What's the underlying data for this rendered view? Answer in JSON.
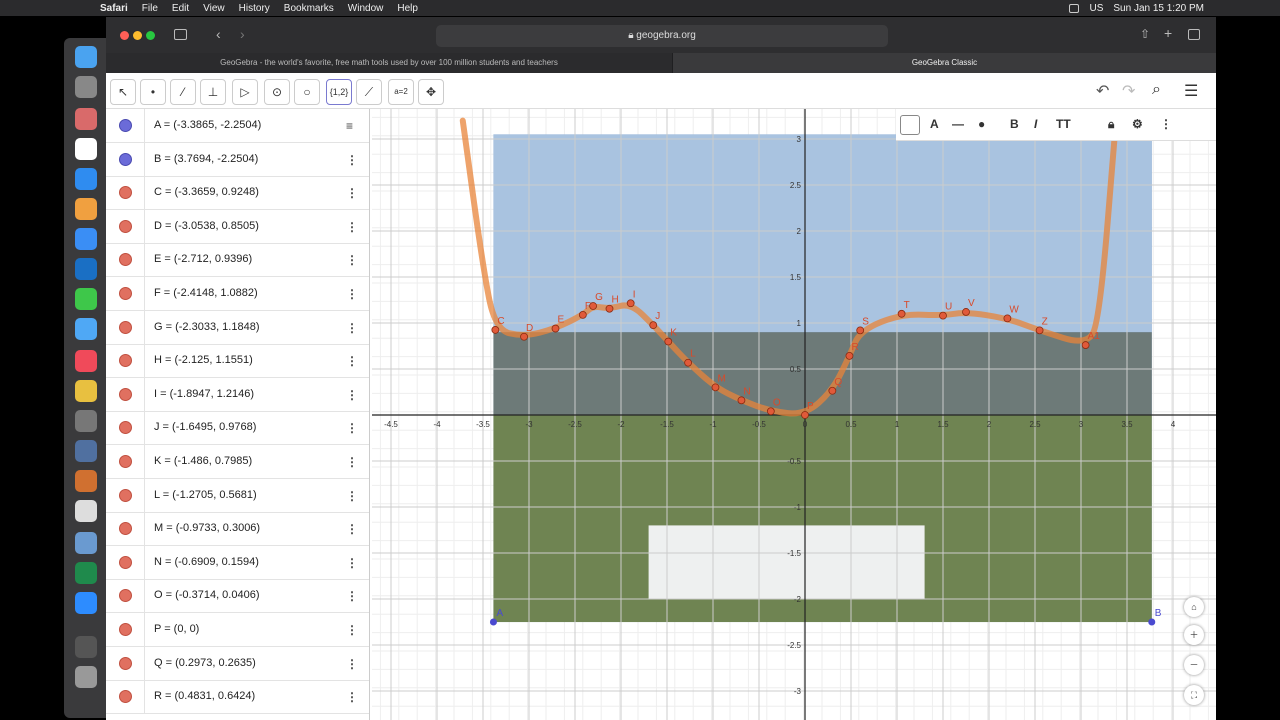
{
  "menubar": {
    "apple": "",
    "app": "Safari",
    "items": [
      "File",
      "Edit",
      "View",
      "History",
      "Bookmarks",
      "Window",
      "Help"
    ],
    "datetime": "Sun Jan 15  1:20 PM",
    "input": "US"
  },
  "browser": {
    "url": "geogebra.org",
    "tab1": "GeoGebra - the world's favorite, free math tools used by over 100 million students and teachers",
    "tab2": "GeoGebra Classic"
  },
  "toolbar": {
    "tools": [
      "move-tool",
      "point-tool",
      "line-tool",
      "perpendicular-tool",
      "polygon-tool",
      "circle-tool",
      "circle-3pt-tool",
      "list-tool",
      "reflect-tool",
      "slider-tool",
      "move-view-tool"
    ],
    "list_label": "{1,2}",
    "slider_label": "a=2"
  },
  "stylebar": {
    "bold": "B",
    "italic": "I",
    "text": "TT"
  },
  "algebra": {
    "rows": [
      {
        "text": "A = (-3.3865, -2.2504)",
        "color": "#6b6bd8"
      },
      {
        "text": "B = (3.7694, -2.2504)",
        "color": "#6b6bd8"
      },
      {
        "text": "C = (-3.3659, 0.9248)",
        "color": "#e07060"
      },
      {
        "text": "D = (-3.0538, 0.8505)",
        "color": "#e07060"
      },
      {
        "text": "E = (-2.712, 0.9396)",
        "color": "#e07060"
      },
      {
        "text": "F = (-2.4148, 1.0882)",
        "color": "#e07060"
      },
      {
        "text": "G = (-2.3033, 1.1848)",
        "color": "#e07060"
      },
      {
        "text": "H = (-2.125, 1.1551)",
        "color": "#e07060"
      },
      {
        "text": "I = (-1.8947, 1.2146)",
        "color": "#e07060"
      },
      {
        "text": "J = (-1.6495, 0.9768)",
        "color": "#e07060"
      },
      {
        "text": "K = (-1.486, 0.7985)",
        "color": "#e07060"
      },
      {
        "text": "L = (-1.2705, 0.5681)",
        "color": "#e07060"
      },
      {
        "text": "M = (-0.9733, 0.3006)",
        "color": "#e07060"
      },
      {
        "text": "N = (-0.6909, 0.1594)",
        "color": "#e07060"
      },
      {
        "text": "O = (-0.3714, 0.0406)",
        "color": "#e07060"
      },
      {
        "text": "P = (0, 0)",
        "color": "#e07060"
      },
      {
        "text": "Q = (0.2973, 0.2635)",
        "color": "#e07060"
      },
      {
        "text": "R = (0.4831, 0.6424)",
        "color": "#e07060"
      }
    ]
  },
  "graph": {
    "x_ticks": [
      -4.5,
      -4,
      -3.5,
      -3,
      -2.5,
      -2,
      -1.5,
      -1,
      -0.5,
      0,
      0.5,
      1,
      1.5,
      2,
      2.5,
      3,
      3.5,
      4
    ],
    "y_ticks": [
      3,
      2.5,
      2,
      1.5,
      1,
      0.5,
      -0.5,
      -1,
      -1.5,
      -2,
      -2.5,
      -3
    ],
    "x_tick_labels": [
      "-4.5",
      "-4",
      "-3.5",
      "-3",
      "-2.5",
      "-2",
      "-1.5",
      "-1",
      "-0.5",
      "0",
      "0.5",
      "1",
      "1.5",
      "2",
      "2.5",
      "3",
      "3.5",
      "4"
    ],
    "y_tick_labels": [
      "3",
      "2.5",
      "2",
      "1.5",
      "1",
      "0.5",
      "-0.5",
      "-1",
      "-1.5",
      "-2",
      "-2.5",
      "-3"
    ],
    "curve_color": "#e8843a",
    "points": [
      {
        "name": "C",
        "x": -3.3659,
        "y": 0.9248
      },
      {
        "name": "D",
        "x": -3.0538,
        "y": 0.8505
      },
      {
        "name": "E",
        "x": -2.712,
        "y": 0.9396
      },
      {
        "name": "F",
        "x": -2.4148,
        "y": 1.0882
      },
      {
        "name": "G",
        "x": -2.3033,
        "y": 1.1848
      },
      {
        "name": "H",
        "x": -2.125,
        "y": 1.1551
      },
      {
        "name": "I",
        "x": -1.8947,
        "y": 1.2146
      },
      {
        "name": "J",
        "x": -1.6495,
        "y": 0.9768
      },
      {
        "name": "K",
        "x": -1.486,
        "y": 0.7985
      },
      {
        "name": "L",
        "x": -1.2705,
        "y": 0.5681
      },
      {
        "name": "M",
        "x": -0.9733,
        "y": 0.3006
      },
      {
        "name": "N",
        "x": -0.6909,
        "y": 0.1594
      },
      {
        "name": "O",
        "x": -0.3714,
        "y": 0.0406
      },
      {
        "name": "P",
        "x": 0,
        "y": 0
      },
      {
        "name": "Q",
        "x": 0.2973,
        "y": 0.2635
      },
      {
        "name": "R",
        "x": 0.4831,
        "y": 0.6424
      },
      {
        "name": "S",
        "x": 0.6,
        "y": 0.92
      },
      {
        "name": "T",
        "x": 1.05,
        "y": 1.1
      },
      {
        "name": "U",
        "x": 1.5,
        "y": 1.08
      },
      {
        "name": "V",
        "x": 1.75,
        "y": 1.12
      },
      {
        "name": "W",
        "x": 2.2,
        "y": 1.05
      },
      {
        "name": "Z",
        "x": 2.55,
        "y": 0.92
      },
      {
        "name": "A1",
        "x": 3.05,
        "y": 0.76
      }
    ],
    "anchors": [
      {
        "name": "A",
        "x": -3.3865,
        "y": -2.2504
      },
      {
        "name": "B",
        "x": 3.7694,
        "y": -2.2504
      }
    ]
  }
}
